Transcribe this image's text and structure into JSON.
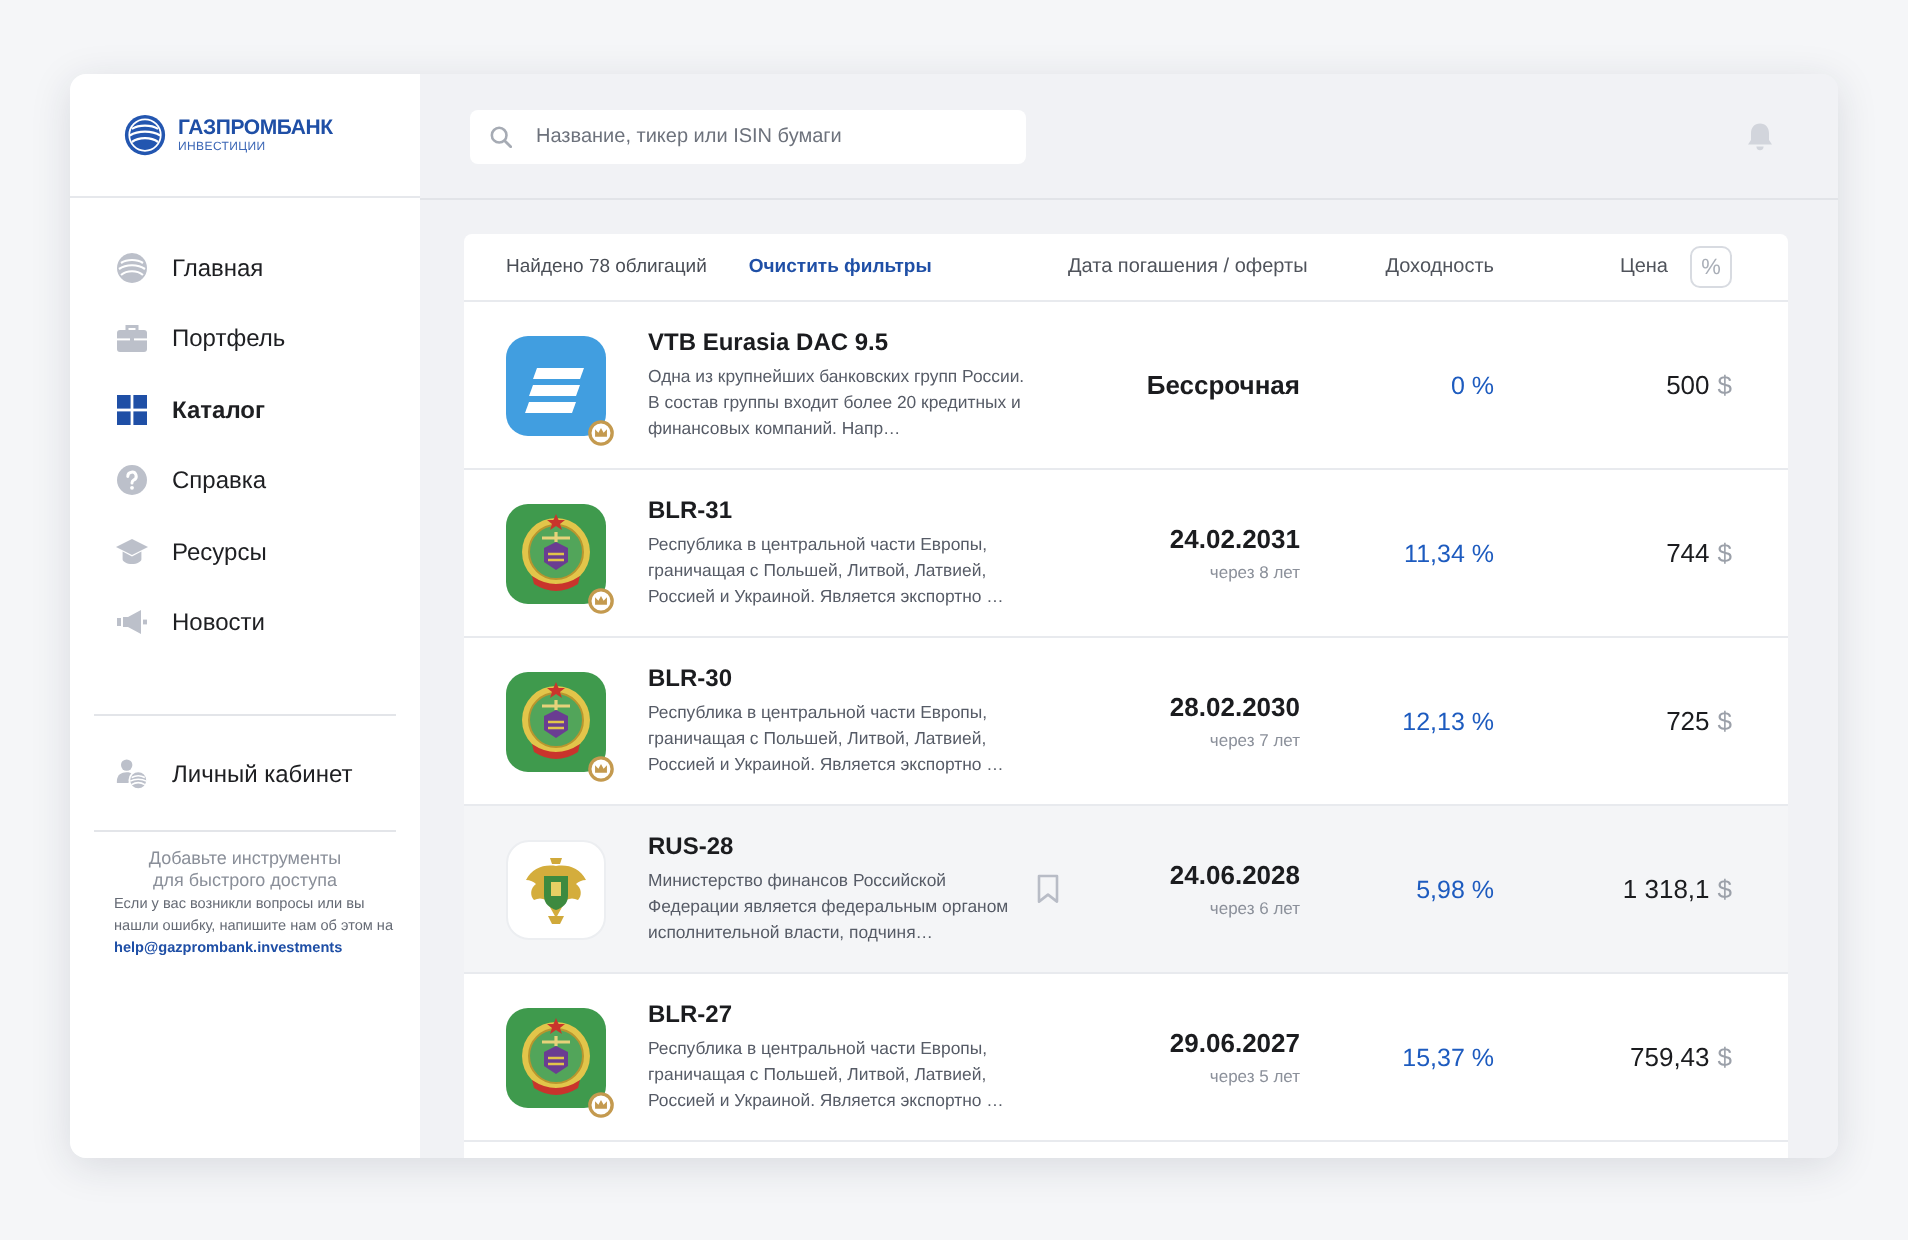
{
  "sidebar": {
    "logo": {
      "name": "ГАЗПРОМБАНК",
      "subtitle": "ИНВЕСТИЦИИ"
    },
    "nav": [
      {
        "label": "Главная",
        "selected": false
      },
      {
        "label": "Портфель",
        "selected": false
      },
      {
        "label": "Каталог",
        "selected": true
      },
      {
        "label": "Справка",
        "selected": false
      },
      {
        "label": "Ресурсы",
        "selected": false
      },
      {
        "label": "Новости",
        "selected": false
      }
    ],
    "account": {
      "label": "Личный кабинет"
    },
    "hint": "Добавьте инструменты для быстрого доступа",
    "help": {
      "text": "Если у вас возникли вопросы или вы нашли ошибку, напишите нам об этом на",
      "link": "help@gazprombank.investments"
    }
  },
  "header": {
    "search": {
      "placeholder": "Название, тикер или ISIN бумаги"
    }
  },
  "table": {
    "found": "Найдено 78 облигаций",
    "clear_filters": "Очистить фильтры",
    "columns": [
      "Дата погашения / оферты",
      "Доходность",
      "Цена"
    ],
    "percent_toggle": "%",
    "rows": [
      {
        "kind": "stripes",
        "badge": true,
        "highlighted": false,
        "name": "VTB Eurasia DAC 9.5",
        "description": "Одна из крупнейших банковских групп России. В состав группы входит более 20 кредитных и финансовых компаний. Напр…",
        "date": "Бессрочная",
        "yield": "0 %",
        "price": "500",
        "currency": "$"
      },
      {
        "kind": "emblem",
        "badge": true,
        "highlighted": false,
        "name": "BLR-31",
        "description": "Республика в центральной части Европы, граничащая с Польшей, Литвой, Латвией, Россией и Украиной. Является экспортно …",
        "date": "24.02.2031",
        "term": "через 8 лет",
        "yield": "11,34 %",
        "price": "744",
        "currency": "$"
      },
      {
        "kind": "emblem",
        "badge": true,
        "highlighted": false,
        "name": "BLR-30",
        "description": "Республика в центральной части Европы, граничащая с Польшей, Литвой, Латвией, Россией и Украиной. Является экспортно …",
        "date": "28.02.2030",
        "term": "через 7 лет",
        "yield": "12,13 %",
        "price": "725",
        "currency": "$"
      },
      {
        "kind": "eagle",
        "badge": false,
        "highlighted": true,
        "name": "RUS-28",
        "description": "Министерство финансов Российской Федерации является федеральным органом исполнительной власти, подчиня…",
        "date": "24.06.2028",
        "term": "через 6 лет",
        "yield": "5,98 %",
        "price": "1 318,1",
        "currency": "$"
      },
      {
        "kind": "emblem",
        "badge": true,
        "highlighted": false,
        "name": "BLR-27",
        "description": "Республика в центральной части Европы, граничащая с Польшей, Литвой, Латвией, Россией и Украиной. Является экспортно …",
        "date": "29.06.2027",
        "term": "через 5 лет",
        "yield": "15,37 %",
        "price": "759,43",
        "currency": "$"
      }
    ]
  }
}
